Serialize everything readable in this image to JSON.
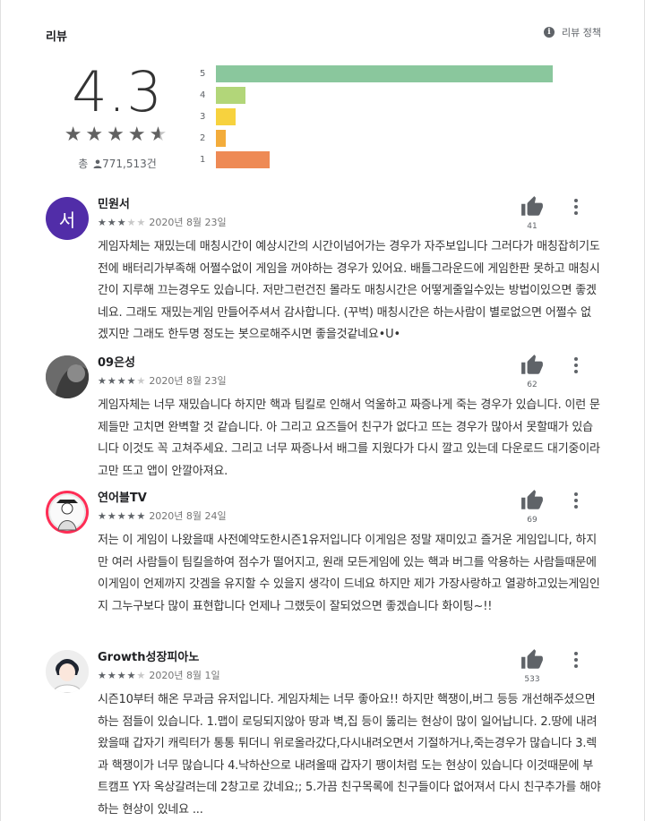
{
  "header": {
    "title": "리뷰",
    "policy_label": "리뷰 정책",
    "policy_icon": "info-icon"
  },
  "summary": {
    "score": "4.3",
    "stars": 4.5,
    "stars_text": "★★★★",
    "half_star": "★",
    "total_prefix": "총",
    "total_icon": "person-icon",
    "total_count": "771,513건"
  },
  "rating_bars": [
    {
      "label": "5",
      "fraction": 1.0,
      "color": "#8ac79d"
    },
    {
      "label": "4",
      "fraction": 0.087,
      "color": "#b2d679"
    },
    {
      "label": "3",
      "fraction": 0.058,
      "color": "#f7d23e"
    },
    {
      "label": "2",
      "fraction": 0.029,
      "color": "#f3ac3b"
    },
    {
      "label": "1",
      "fraction": 0.16,
      "color": "#ee8a55"
    }
  ],
  "reviews": [
    {
      "name": "민원서",
      "avatar_text": "서",
      "avatar_color": "#512da8",
      "rating": 3,
      "stars_on": "★★★",
      "stars_off": "★★",
      "date": "2020년 8월 23일",
      "likes": "41",
      "body": "게임자체는 재밌는데 매칭시간이 예상시간의 시간이넘어가는 경우가 자주보입니다 그러다가 매칭잡히기도 전에 배터리가부족해 어쩔수없이 게임을 꺼야하는 경우가 있어요. 배틀그라운드에 게임한판 못하고 매칭시간이 지루해 끄는경우도 있습니다. 저만그런건진 몰라도 매칭시간은 어떻게줄일수있는 방법이있으면 좋겠네요. 그래도 재밌는게임 만들어주셔서 감사합니다. (꾸벅) 매칭시간은 하는사람이 별로없으면 어쩔수 없겠지만 그래도 한두명 정도는 봇으로해주시면 좋을것같네요•U•"
    },
    {
      "name": "09은성",
      "avatar_text": "",
      "avatar_color": "#6d6d6d",
      "rating": 4,
      "stars_on": "★★★★",
      "stars_off": "★",
      "date": "2020년 8월 23일",
      "likes": "62",
      "body": "게임자체는 너무 재밌습니다 하지만 핵과 팀킬로 인해서 억울하고 짜증나게 죽는 경우가 있습니다. 이런 문제들만 고치면 완벽할 것 같습니다. 아 그리고 요즈들어 친구가 없다고 뜨는 경우가 많아서 못할때가 있습니다 이것도 꼭 고쳐주세요. 그리고 너무 짜증나서 배그를 지웠다가 다시 깔고 있는데 다운로드 대기중이라고만 뜨고 앱이 안깔아져요."
    },
    {
      "name": "연어블TV",
      "avatar_text": "",
      "avatar_color": "#e8e8e8",
      "rating": 5,
      "stars_on": "★★★★★",
      "stars_off": "",
      "date": "2020년 8월 24일",
      "likes": "69",
      "body": "저는 이 게임이 나왔을때 사전예약도한시즌1유저입니다 이게임은 정말 재미있고 즐거운 게임입니다, 하지만 여러 사람들이 팀킬을하여 점수가 떨어지고, 원래 모든게임에 있는 핵과 버그를 악용하는 사람들때문에 이게임이 언제까지 갓겜을 유지할 수 있을지 생각이 드네요 하지만 제가 가장사랑하고 열광하고있는게임인지 그누구보다 많이 표현합니다 언제나 그랬듯이 잘되었으면 좋겠습니다 화이팅~!!"
    },
    {
      "name": "Growth성장피아노",
      "avatar_text": "",
      "avatar_color": "#f0f0f0",
      "rating": 4,
      "stars_on": "★★★★",
      "stars_off": "★",
      "date": "2020년 8월 1일",
      "likes": "533",
      "body": "시즌10부터 해온 무과금 유저입니다. 게임자체는 너무 좋아요!! 하지만 핵쟁이,버그 등등 개선해주셨으면 하는 점들이 있습니다. 1.맵이 로딩되지않아 땅과 벽,집 등이 뚫리는 현상이 많이 일어납니다. 2.땅에 내려왔을때 갑자기 캐릭터가 통통 튀더니 위로올라갔다,다시내려오면서 기절하거나,죽는경우가 많습니다 3.렉과 핵쟁이가 너무 많습니다 4.낙하산으로 내려올때 갑자기 팽이처럼 도는 현상이 있습니다 이것때문에 부트캠프 Y자 옥상갈려는데 2창고로 갔네요;; 5.가끔 친구목록에 친구들이다 없어져서 다시 친구추가를 해야하는 현상이 있네요 ..."
    }
  ]
}
